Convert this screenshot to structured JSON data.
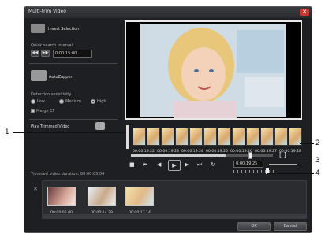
{
  "window": {
    "title": "Multi-trim Video",
    "close_glyph": "✕"
  },
  "left": {
    "invert_label": "Invert Selection",
    "quick_interval_label": "Quick search interval",
    "interval_value": "0:00:15:00",
    "autozapper_label": "AutoZapper",
    "detection_label": "Detection sensitivity",
    "sensitivity_options": [
      {
        "label": "Low",
        "selected": false
      },
      {
        "label": "Medium",
        "selected": false
      },
      {
        "label": "High",
        "selected": true
      }
    ],
    "merge_label": "Merge CF",
    "play_trimmed_label": "Play Trimmed Video"
  },
  "timeline": {
    "timecodes": [
      "00:00:19.22",
      "00:00:19.23",
      "00:00:19.24",
      "00:00:19.25",
      "00:00:19.26",
      "00:00:19.27",
      "00:00:19.28"
    ],
    "zoom_readout": "0:00:19:25",
    "playhead_position_fraction": 0.83
  },
  "controls": {
    "stop": "■",
    "home": "⏮",
    "prev": "◀",
    "play": "▶",
    "next": "▶",
    "end": "⏭",
    "repeat": "↻"
  },
  "trimmed": {
    "duration_label": "Trimmed video duration: 00:00:03.04",
    "delete_glyph": "✕",
    "clips": [
      {
        "time": "00:00:05.00"
      },
      {
        "time": "00:00:14.29"
      },
      {
        "time": "00:00:17.14"
      }
    ]
  },
  "footer": {
    "ok_label": "OK",
    "cancel_label": "Cancel"
  },
  "callouts": [
    "1",
    "2",
    "3",
    "4"
  ],
  "colors": {
    "window_bg": "#1e1f22",
    "preview_border": "#e8e8e8",
    "accent": "#c33"
  }
}
